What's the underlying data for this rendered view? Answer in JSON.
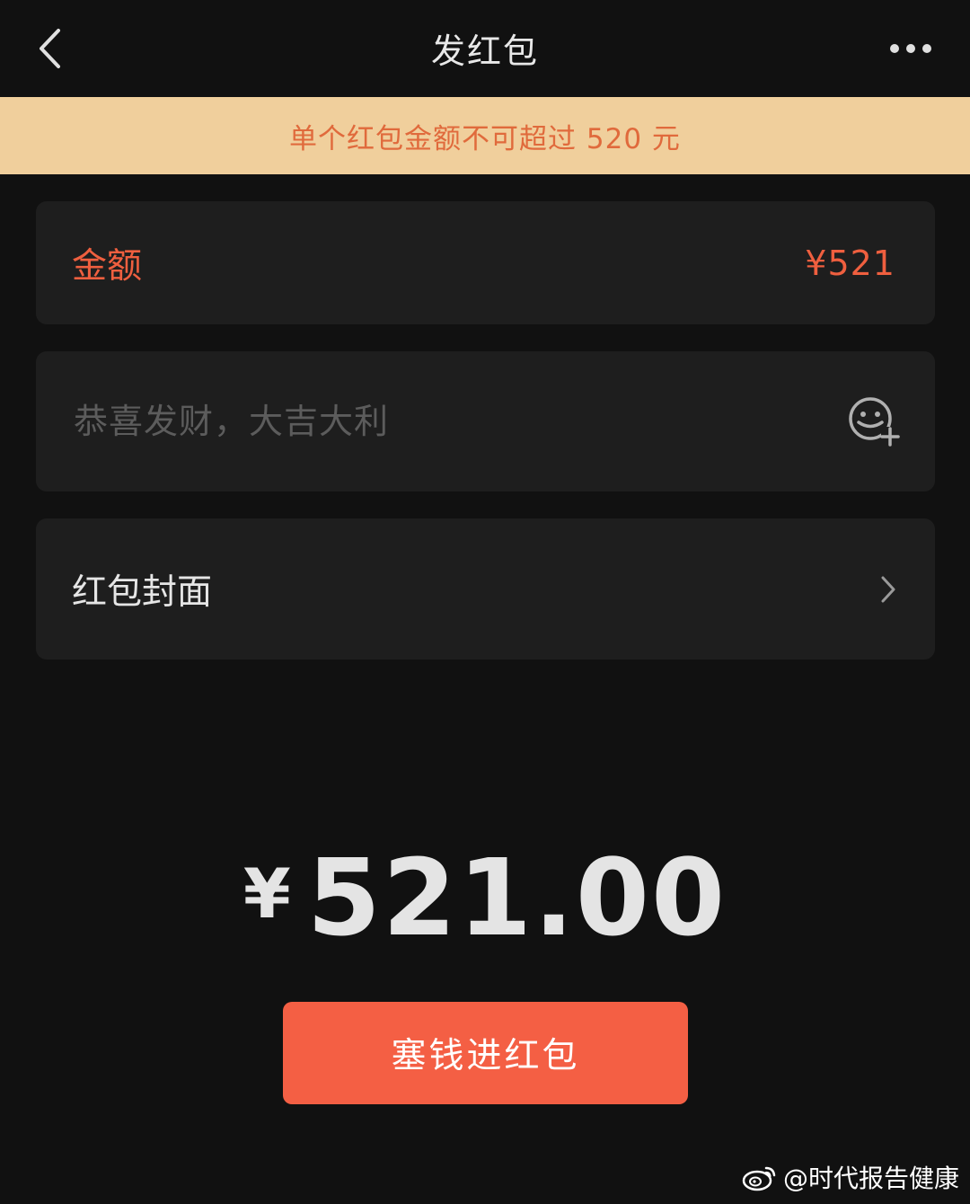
{
  "navbar": {
    "title": "发红包"
  },
  "banner": {
    "text": "单个红包金额不可超过 520 元"
  },
  "amount_card": {
    "label": "金额",
    "value": "¥521"
  },
  "message_card": {
    "placeholder": "恭喜发财，大吉大利"
  },
  "cover_card": {
    "label": "红包封面"
  },
  "total": {
    "currency": "¥",
    "amount": "521.00"
  },
  "send_button": {
    "label": "塞钱进红包"
  },
  "watermark": {
    "text": "@时代报告健康"
  },
  "colors": {
    "background": "#111111",
    "card": "#1e1e1e",
    "banner_bg": "#f0cf9c",
    "accent": "#ef5f3f",
    "button": "#f45f44"
  },
  "icons": {
    "back": "chevron-left-icon",
    "more": "more-dots-icon",
    "emoji": "emoji-add-icon",
    "cover_arrow": "chevron-right-icon",
    "watermark_logo": "weibo-logo-icon"
  }
}
